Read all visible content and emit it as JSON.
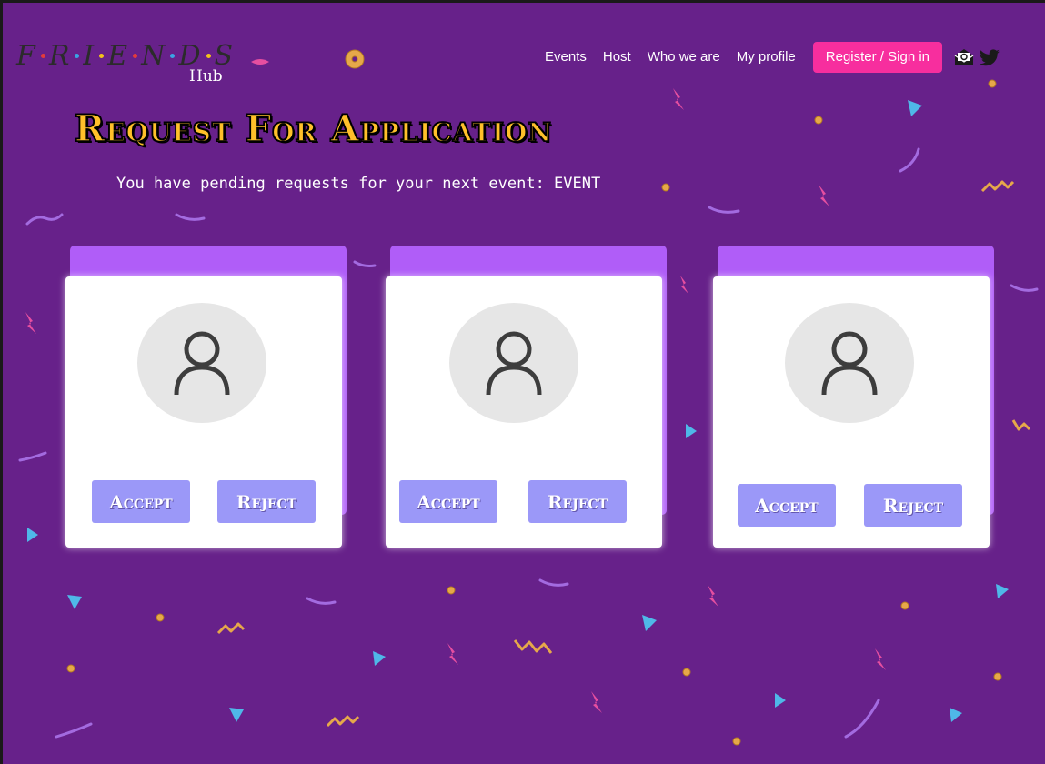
{
  "brand": {
    "letters": [
      "F",
      "R",
      "I",
      "E",
      "N",
      "D",
      "S"
    ],
    "dot_colors": [
      "#e33b3b",
      "#3ba3e3",
      "#f3c21b",
      "#e33b3b",
      "#3ba3e3",
      "#f3c21b"
    ],
    "sub": "Hub"
  },
  "nav": {
    "links": [
      "Events",
      "Host",
      "Who we are",
      "My profile"
    ],
    "register_label": "Register / Sign in",
    "icons": [
      "mail-icon",
      "twitter-icon"
    ]
  },
  "page": {
    "title": "Request For Application",
    "subtitle": "You have pending requests for your next event: EVENT"
  },
  "cards": [
    {
      "accept_label": "Accept",
      "reject_label": "Reject"
    },
    {
      "accept_label": "Accept",
      "reject_label": "Reject"
    },
    {
      "accept_label": "Accept",
      "reject_label": "Reject"
    }
  ],
  "colors": {
    "background": "#67218a",
    "title": "#ffc02a",
    "register_button": "#f72e9e",
    "card_accent": "#b05df8",
    "action_button": "#9b98f8",
    "avatar_bg": "#e6e6e6"
  }
}
